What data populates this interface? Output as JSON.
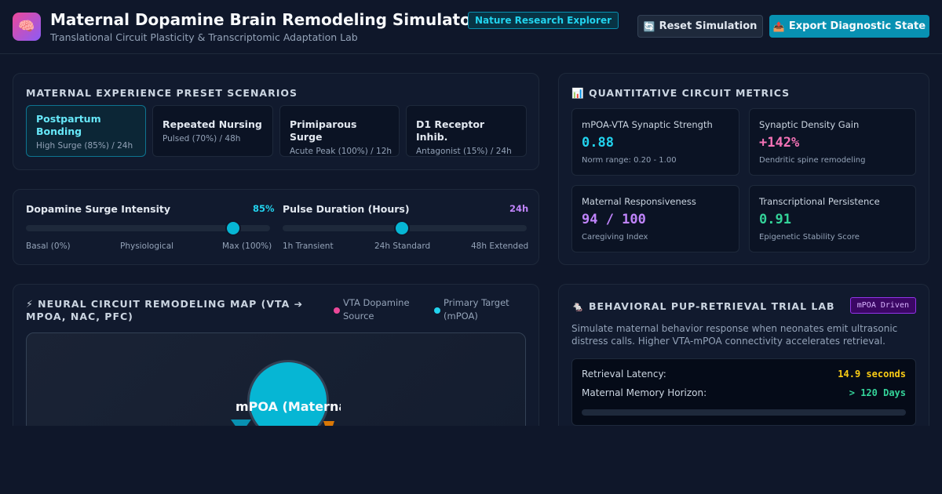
{
  "header": {
    "logo_icon": "🧠",
    "title": "Maternal Dopamine Brain Remodeling Simulator",
    "badge": "Nature Research Explorer",
    "subtitle": "Translational Circuit Plasticity & Transcriptomic Adaptation Lab",
    "reset_icon": "🔄",
    "reset_label": "Reset Simulation",
    "export_icon": "📤",
    "export_label": "Export Diagnostic State"
  },
  "presets": {
    "title": "MATERNAL EXPERIENCE PRESET SCENARIOS",
    "active_index": 0,
    "items": [
      {
        "name": "Postpartum Bonding",
        "detail": "High Surge (85%) / 24h"
      },
      {
        "name": "Repeated Nursing",
        "detail": "Pulsed (70%) / 48h"
      },
      {
        "name": "Primiparous Surge",
        "detail": "Acute Peak (100%) / 12h"
      },
      {
        "name": "D1 Receptor Inhib.",
        "detail": "Antagonist (15%) / 24h"
      }
    ]
  },
  "controls": {
    "intensity": {
      "label": "Dopamine Surge Intensity",
      "value_text": "85%",
      "level": 0.85,
      "ticks": [
        "Basal (0%)",
        "Physiological",
        "Max (100%)"
      ]
    },
    "duration": {
      "label": "Pulse Duration (Hours)",
      "value_text": "24h",
      "level": 0.49,
      "ticks": [
        "1h Transient",
        "24h Standard",
        "48h Extended"
      ]
    }
  },
  "metrics": {
    "icon": "📊",
    "title": "QUANTITATIVE CIRCUIT METRICS",
    "items": [
      {
        "label": "mPOA-VTA Synaptic Strength",
        "value": "0.88",
        "sub": "Norm range: 0.20 - 1.00",
        "color": "#22d3ee"
      },
      {
        "label": "Synaptic Density Gain",
        "value": "+142%",
        "sub": "Dendritic spine remodeling",
        "color": "#f472b6"
      },
      {
        "label": "Maternal Responsiveness",
        "value": "94 / 100",
        "sub": "Caregiving Index",
        "color": "#c084fc"
      },
      {
        "label": "Transcriptional Persistence",
        "value": "0.91",
        "sub": "Epigenetic Stability Score",
        "color": "#34d399"
      }
    ]
  },
  "circuit_map": {
    "icon": "⚡",
    "title": "NEURAL CIRCUIT REMODELING MAP (VTA ➔ MPOA, NAC, PFC)",
    "legend": [
      {
        "label": "VTA Dopamine Source",
        "color": "#ec4899"
      },
      {
        "label": "Primary Target (mPOA)",
        "color": "#22d3ee"
      }
    ],
    "node_label": "mPOA (Maternal Hub)",
    "node_color": "#06b6d4"
  },
  "behavior_lab": {
    "icon": "🐁",
    "title": "BEHAVIORAL PUP-RETRIEVAL TRIAL LAB",
    "badge": "mPOA Driven",
    "description": "Simulate maternal behavior response when neonates emit ultrasonic distress calls. Higher VTA-mPOA connectivity accelerates retrieval.",
    "rows": [
      {
        "label": "Retrieval Latency:",
        "value": "14.9 seconds",
        "color": "#facc15"
      },
      {
        "label": "Maternal Memory Horizon:",
        "value": "> 120 Days",
        "color": "#34d399"
      }
    ],
    "progress": 0.0
  }
}
